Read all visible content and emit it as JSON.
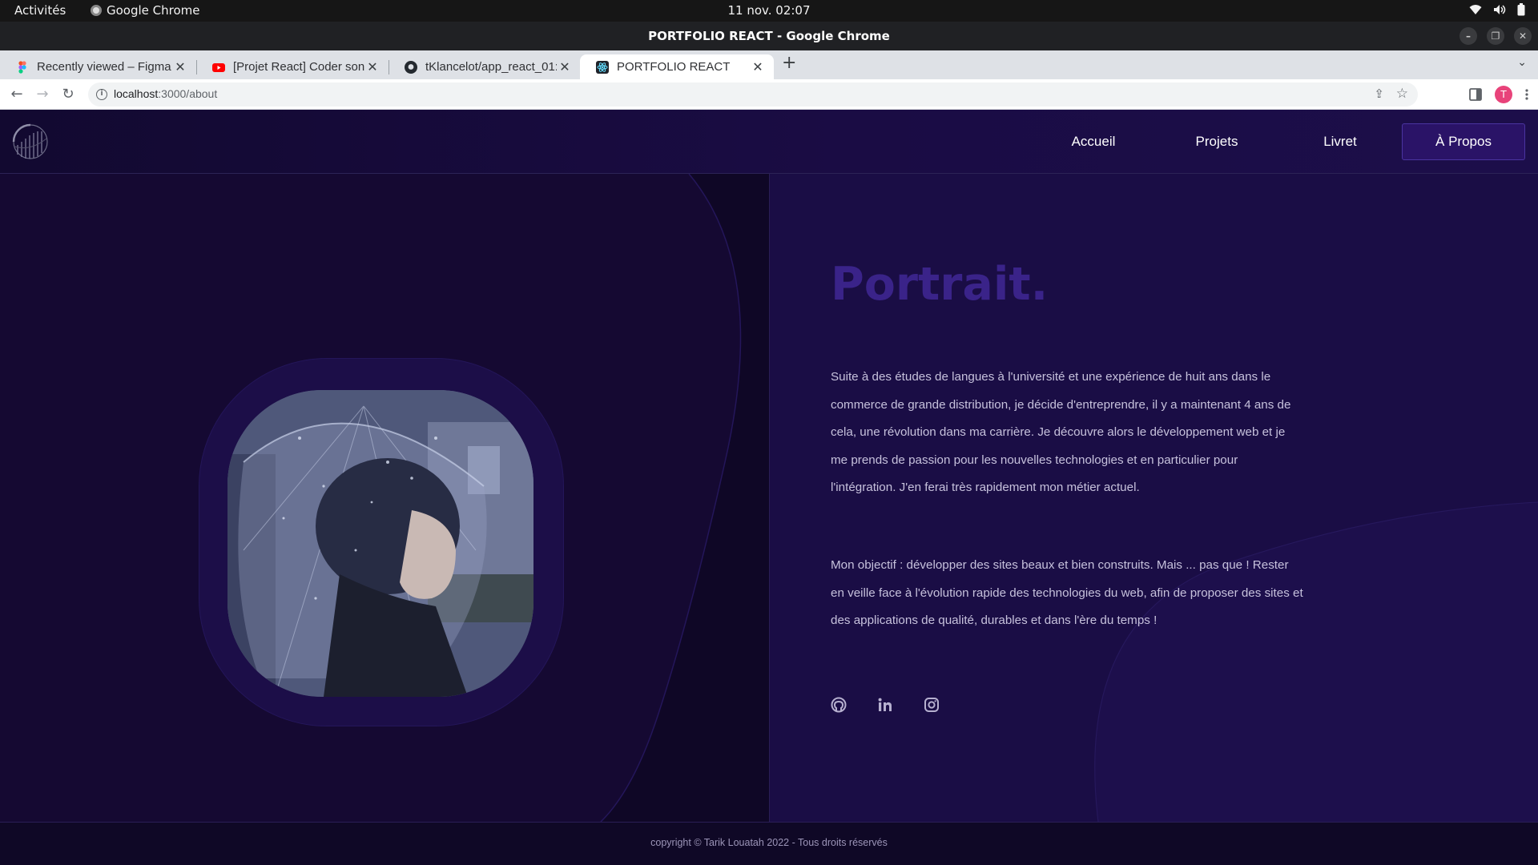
{
  "system_bar": {
    "activities": "Activités",
    "app_name": "Google Chrome",
    "clock": "11 nov.  02:07"
  },
  "window": {
    "title": "PORTFOLIO REACT - Google Chrome"
  },
  "tabs": [
    {
      "label": "Recently viewed – Figma",
      "icon": "figma-icon"
    },
    {
      "label": "[Projet React] Coder son C",
      "icon": "youtube-icon"
    },
    {
      "label": "tKlancelot/app_react_01:",
      "icon": "github-icon"
    },
    {
      "label": "PORTFOLIO REACT",
      "icon": "react-icon",
      "active": true
    }
  ],
  "omnibox": {
    "host": "localhost",
    "path": ":3000/about"
  },
  "profile": {
    "initial": "T",
    "color": "#e8437a"
  },
  "site": {
    "nav": [
      {
        "label": "Accueil"
      },
      {
        "label": "Projets"
      },
      {
        "label": "Livret"
      },
      {
        "label": "À Propos",
        "active": true
      }
    ],
    "heading": "Portrait.",
    "paragraph1": "Suite à des études de langues à l'université et une expérience de huit ans dans le commerce de grande distribution, je décide d'entreprendre, il y a maintenant 4 ans de cela, une révolution dans ma carrière. Je découvre alors le développement web et je me prends de passion pour les nouvelles technologies et en particulier pour l'intégration. J'en ferai très rapidement mon métier actuel.",
    "paragraph2": "Mon objectif : développer des sites beaux et bien construits. Mais ... pas que ! Rester en veille face à l'évolution rapide des technologies du web, afin de proposer des sites et des applications de qualité, durables et dans l'ère du temps !",
    "socials": [
      "github-icon",
      "linkedin-icon",
      "instagram-icon"
    ],
    "footer": "copyright © Tarik Louatah 2022 - Tous droits réservés",
    "colors": {
      "accent": "#3a2389",
      "background": "#160b3a",
      "active_nav": "#2a1367"
    }
  }
}
